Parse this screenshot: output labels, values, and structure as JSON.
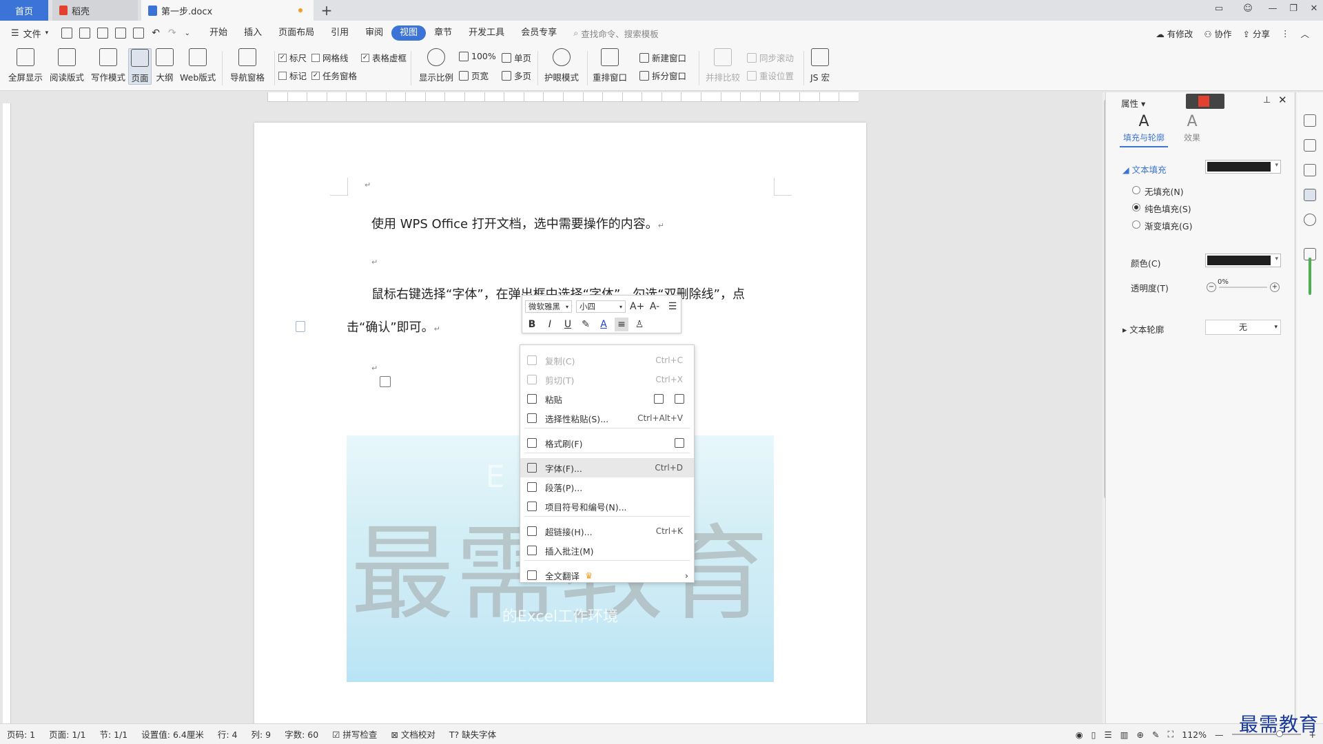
{
  "tabs": {
    "home": "首页",
    "daoke": "稻壳",
    "doc": "第一步.docx"
  },
  "menu": {
    "file": "文件",
    "items": [
      "开始",
      "插入",
      "页面布局",
      "引用",
      "审阅",
      "视图",
      "章节",
      "开发工具",
      "会员专享"
    ],
    "active_index": 5,
    "search_placeholder": "查找命令、搜索模板",
    "right": [
      "有修改",
      "协作",
      "分享"
    ]
  },
  "ribbon": {
    "buttons": [
      "全屏显示",
      "阅读版式",
      "写作模式",
      "页面",
      "大纲",
      "Web版式"
    ],
    "nav_pane": "导航窗格",
    "checks": [
      {
        "label": "标尺",
        "checked": true
      },
      {
        "label": "网格线",
        "checked": false
      },
      {
        "label": "表格虚框",
        "checked": true
      },
      {
        "label": "标记",
        "checked": false
      },
      {
        "label": "任务窗格",
        "checked": true
      }
    ],
    "zoom": "显示比例",
    "zoom100": "100%",
    "single_page": "单页",
    "page_width": "页宽",
    "multi_page": "多页",
    "eye_mode": "护眼模式",
    "rearrange": "重排窗口",
    "new_window": "新建窗口",
    "split_window": "拆分窗口",
    "side_by_side": "并排比较",
    "sync_scroll": "同步滚动",
    "reset_pos": "重设位置",
    "js_macro": "JS 宏"
  },
  "document": {
    "p1": "使用 WPS Office 打开文档，选中需要操作的内容。",
    "p2a": "鼠标右键选择“字体”，在弹出框中选择“字体”，勾选“双删除线”，点",
    "p2b": "击“确认”即可。",
    "mark": "↵",
    "image": {
      "wm_main": "最需教育",
      "wm_sub": "的Excel工作环境",
      "wm_top": "Excel"
    }
  },
  "minibar": {
    "font": "微软雅黑",
    "size": "小四",
    "grow": "A+",
    "shrink": "A-",
    "bold": "B",
    "italic": "I",
    "underline": "U",
    "font_color_glyph": "A"
  },
  "context_menu": [
    {
      "label": "复制(C)",
      "shortcut": "Ctrl+C",
      "disabled": true,
      "icon": "copy-icon"
    },
    {
      "label": "剪切(T)",
      "shortcut": "Ctrl+X",
      "disabled": true,
      "icon": "cut-icon"
    },
    {
      "label": "粘贴",
      "shortcut": "",
      "disabled": false,
      "icon": "paste-icon"
    },
    {
      "label": "选择性粘贴(S)...",
      "shortcut": "Ctrl+Alt+V",
      "disabled": false,
      "icon": "paste-special-icon"
    },
    {
      "label": "格式刷(F)",
      "shortcut": "",
      "disabled": false,
      "icon": "format-brush-icon"
    },
    {
      "label": "字体(F)...",
      "shortcut": "Ctrl+D",
      "disabled": false,
      "icon": "font-icon"
    },
    {
      "label": "段落(P)...",
      "shortcut": "",
      "disabled": false,
      "icon": "paragraph-icon"
    },
    {
      "label": "项目符号和编号(N)...",
      "shortcut": "",
      "disabled": false,
      "icon": "list-icon"
    },
    {
      "label": "超链接(H)...",
      "shortcut": "Ctrl+K",
      "disabled": false,
      "icon": "hyperlink-icon"
    },
    {
      "label": "插入批注(M)",
      "shortcut": "",
      "disabled": false,
      "icon": "comment-icon"
    },
    {
      "label": "全文翻译",
      "shortcut": "",
      "disabled": false,
      "icon": "translate-icon"
    }
  ],
  "panel": {
    "title": "属性",
    "tab_fill": "填充与轮廓",
    "tab_effect": "效果",
    "text_fill": "文本填充",
    "no_fill": "无填充(N)",
    "solid_fill": "纯色填充(S)",
    "gradient_fill": "渐变填充(G)",
    "color": "颜色(C)",
    "transparency": "透明度(T)",
    "transparency_value": "0%",
    "text_outline": "文本轮廓",
    "outline_value": "无",
    "fill_color": "#1f1f1f"
  },
  "status": {
    "page_code": "页码: 1",
    "pages": "页面: 1/1",
    "section": "节: 1/1",
    "setting": "设置值: 6.4厘米",
    "row": "行: 4",
    "col": "列: 9",
    "words": "字数: 60",
    "spell": "拼写检查",
    "proof": "文档校对",
    "missing_font": "缺失字体",
    "zoom": "112%"
  },
  "brand": "最需教育",
  "colors": {
    "accent": "#3b74d6",
    "brand": "#1a3a9c"
  }
}
